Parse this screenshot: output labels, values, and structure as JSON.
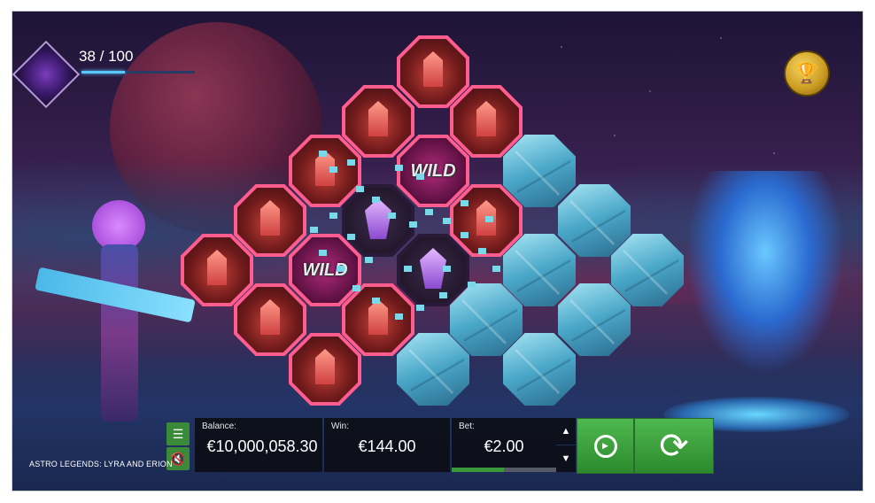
{
  "progress": {
    "text": "38 / 100",
    "current": 38,
    "max": 100
  },
  "trophy_icon": "trophy-icon",
  "wild_label": "WILD",
  "controls": {
    "balance_label": "Balance:",
    "balance_value": "€10,000,058.30",
    "win_label": "Win:",
    "win_value": "€144.00",
    "bet_label": "Bet:",
    "bet_value": "€2.00",
    "bet_level": 0.5
  },
  "game_title": "ASTRO LEGENDS: LYRA AND ERION",
  "colors": {
    "accent_green": "#3a9a3a",
    "cell_glow": "#ff5d8f",
    "progress": "#58c8ff"
  }
}
